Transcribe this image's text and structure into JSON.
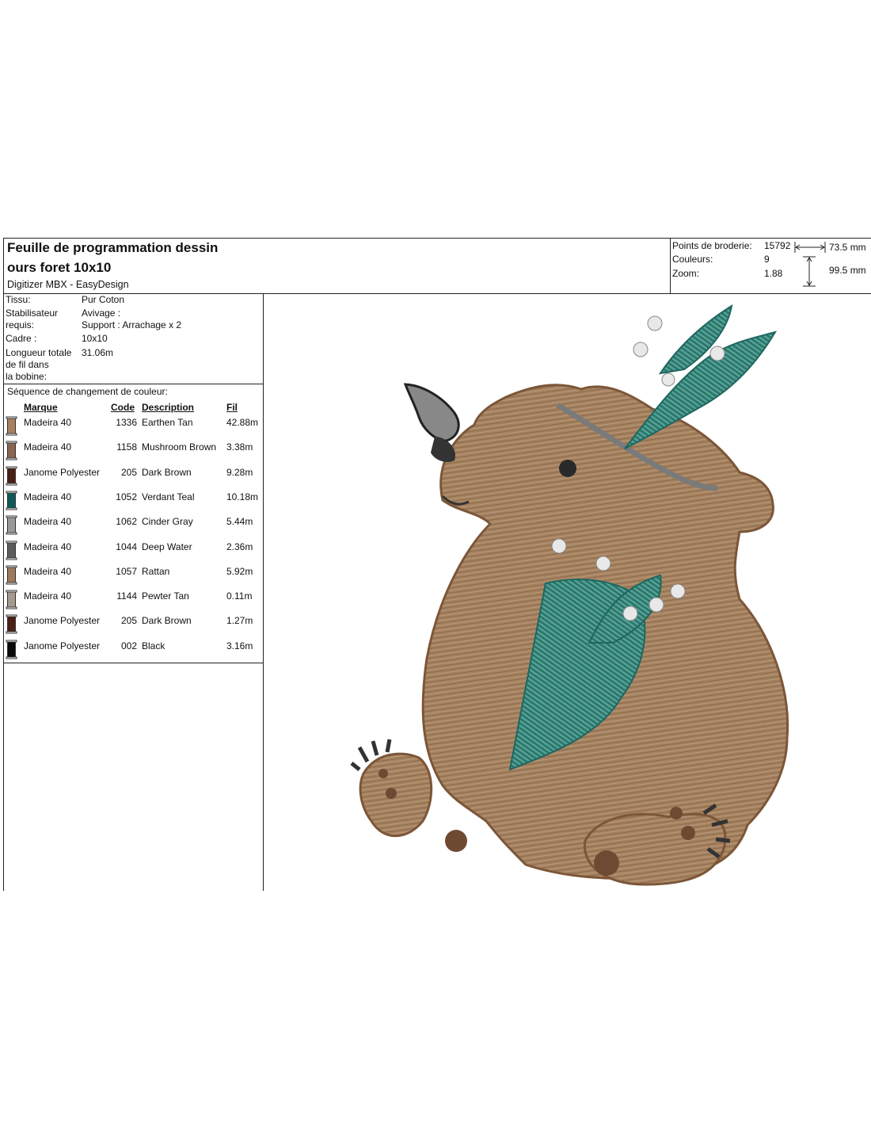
{
  "header": {
    "title_line1": "Feuille de programmation dessin",
    "title_line2": "ours foret 10x10",
    "software": "Digitizer MBX - EasyDesign"
  },
  "stats": {
    "points_label": "Points de broderie:",
    "points_value": "15792",
    "colors_label": "Couleurs:",
    "colors_value": "9",
    "zoom_label": "Zoom:",
    "zoom_value": "1.88",
    "width": "73.5 mm",
    "height": "99.5 mm"
  },
  "info": {
    "fabric_label": "Tissu:",
    "fabric_value": "Pur Coton",
    "stabilizer_label_1": "Stabilisateur",
    "stabilizer_label_2": "requis:",
    "stabilizer_value_1": "Avivage :",
    "stabilizer_value_2": "Support : Arrachage x 2",
    "frame_label": "Cadre :",
    "frame_value": "10x10",
    "thread_label_1": "Longueur totale",
    "thread_label_2": "de fil dans",
    "thread_label_3": "la bobine:",
    "thread_value": "31.06m"
  },
  "sequence": {
    "title": "Séquence de changement de couleur:",
    "headers": {
      "brand": "Marque",
      "code": "Code",
      "description": "Description",
      "length": "Fil"
    },
    "rows": [
      {
        "brand": "Madeira 40",
        "code": "1336",
        "description": "Earthen Tan",
        "length": "42.88m",
        "color": "#a7805f"
      },
      {
        "brand": "Madeira 40",
        "code": "1158",
        "description": "Mushroom Brown",
        "length": "3.38m",
        "color": "#8a6550"
      },
      {
        "brand": "Janome Polyester",
        "code": "205",
        "description": "Dark Brown",
        "length": "9.28m",
        "color": "#4a1f14"
      },
      {
        "brand": "Madeira 40",
        "code": "1052",
        "description": "Verdant Teal",
        "length": "10.18m",
        "color": "#0e5a58"
      },
      {
        "brand": "Madeira 40",
        "code": "1062",
        "description": "Cinder Gray",
        "length": "5.44m",
        "color": "#9a9a9a"
      },
      {
        "brand": "Madeira 40",
        "code": "1044",
        "description": "Deep Water",
        "length": "2.36m",
        "color": "#5c5c5c"
      },
      {
        "brand": "Madeira 40",
        "code": "1057",
        "description": "Rattan",
        "length": "5.92m",
        "color": "#9d7a5e"
      },
      {
        "brand": "Madeira 40",
        "code": "1144",
        "description": "Pewter Tan",
        "length": "0.11m",
        "color": "#a69a8e"
      },
      {
        "brand": "Janome Polyester",
        "code": "205",
        "description": "Dark Brown",
        "length": "1.27m",
        "color": "#4a1f14"
      },
      {
        "brand": "Janome Polyester",
        "code": "002",
        "description": "Black",
        "length": "3.16m",
        "color": "#0a0a0a"
      }
    ]
  }
}
